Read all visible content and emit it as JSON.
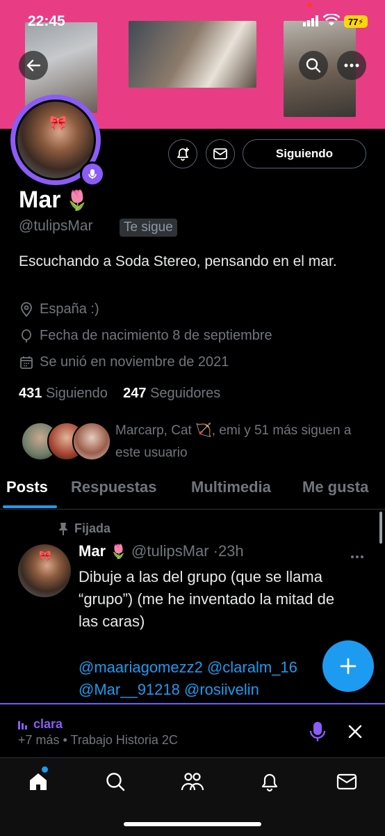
{
  "status_bar": {
    "time": "22:45",
    "battery": "77"
  },
  "profile": {
    "name": "Mar",
    "name_emoji": "🌷",
    "handle": "@tulipsMar",
    "follows_you": "Te sigue",
    "bio": "Escuchando a Soda Stereo, pensando en el mar.",
    "location": "España :)",
    "birthday": "Fecha de nacimiento 8 de septiembre",
    "joined": "Se unió en noviembre de 2021",
    "following_count": "431",
    "following_label": "Siguiendo",
    "followers_count": "247",
    "followers_label": "Seguidores",
    "followed_by_text": "Marcarp, Cat 🏹, emi y 51 más siguen a este usuario",
    "follow_button": "Siguiendo"
  },
  "tabs": [
    {
      "label": "Posts",
      "active": true
    },
    {
      "label": "Respuestas",
      "active": false
    },
    {
      "label": "Multimedia",
      "active": false
    },
    {
      "label": "Me gusta",
      "active": false
    }
  ],
  "tweet": {
    "pinned_label": "Fijada",
    "name": "Mar",
    "name_emoji": "🌷",
    "handle": "@tulipsMar",
    "time": "·23h",
    "text": "Dibuje a las del grupo (que se llama “grupo”) (me he inventado la mitad de las caras)",
    "mentions": "@maariagomezz2 @claralm_16 @Mar__91218 @rosiivelin"
  },
  "space": {
    "title": "clara",
    "subtitle": "+7 más • Trabajo Historia 2C"
  },
  "colors": {
    "accent": "#1d9bf0",
    "spaces": "#8b5cf6",
    "banner": "#e83d85"
  },
  "icons": [
    "back-arrow-icon",
    "search-icon",
    "more-icon",
    "notify-plus-icon",
    "mail-icon",
    "location-icon",
    "birthday-icon",
    "calendar-icon",
    "pin-icon",
    "compose-plus-icon",
    "mic-icon",
    "close-icon",
    "home-icon",
    "explore-icon",
    "communities-icon",
    "bell-icon",
    "messages-icon"
  ]
}
